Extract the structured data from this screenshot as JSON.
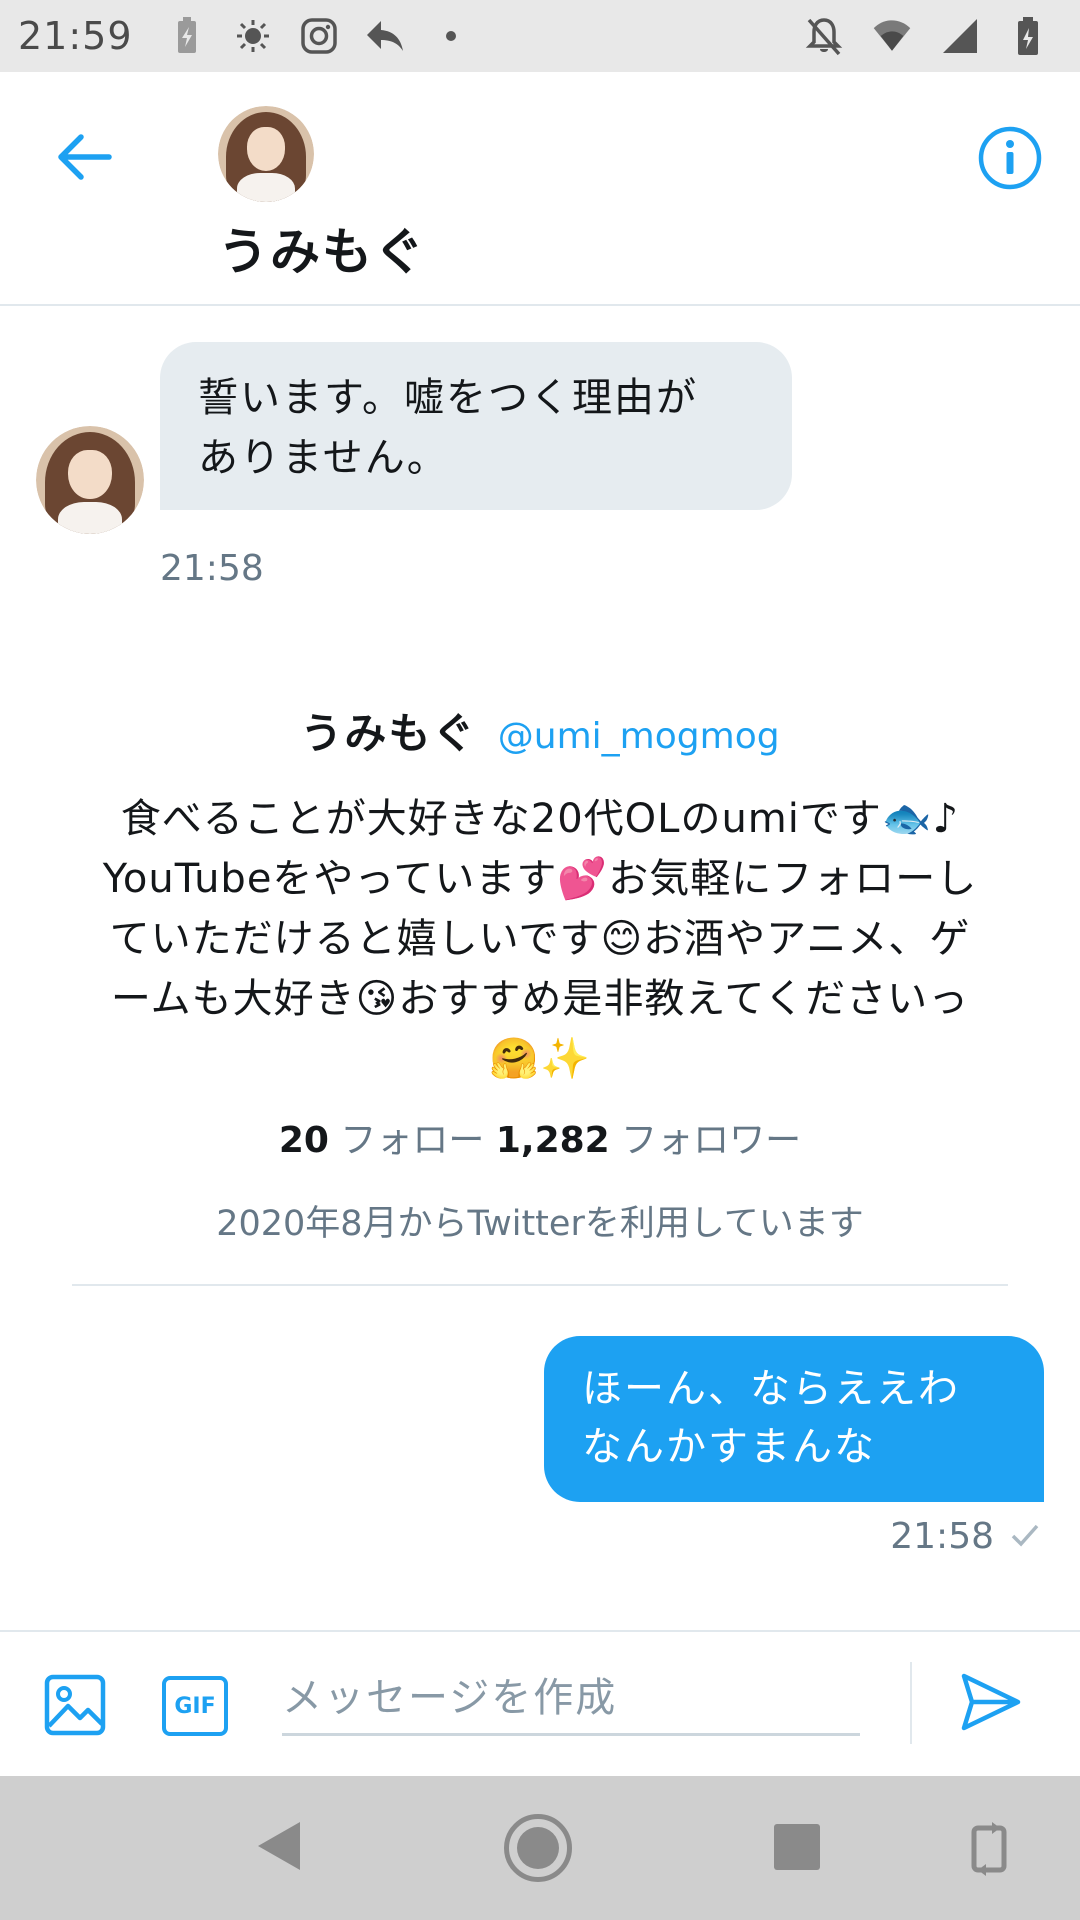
{
  "status_bar": {
    "time": "21:59"
  },
  "header": {
    "contact_name": "うみもぐ"
  },
  "messages": {
    "incoming": {
      "text_line1": "誓います。嘘をつく理由が",
      "text_line2": "ありません。",
      "time": "21:58"
    },
    "outgoing": {
      "text_line1": "ほーん、ならええわ",
      "text_line2": "なんかすまんな",
      "time": "21:58"
    }
  },
  "profile_card": {
    "name": "うみもぐ",
    "handle": "@umi_mogmog",
    "bio_line1": "食べることが大好きな20代OLのumiです🐟♪",
    "bio_line2": "YouTubeをやっています💕お気軽にフォローし",
    "bio_line3": "ていただけると嬉しいです😊お酒やアニメ、ゲ",
    "bio_line4": "ームも大好き😘おすすめ是非教えてくださいっ",
    "bio_line5": "🤗✨",
    "following_count": "20",
    "following_label": "フォロー",
    "followers_count": "1,282",
    "followers_label": "フォロワー",
    "joined": "2020年8月からTwitterを利用しています"
  },
  "composer": {
    "gif_label": "GIF",
    "placeholder": "メッセージを作成"
  },
  "colors": {
    "accent": "#1da1f2",
    "incoming_bubble": "#e6ecf0",
    "muted_text": "#657786"
  }
}
